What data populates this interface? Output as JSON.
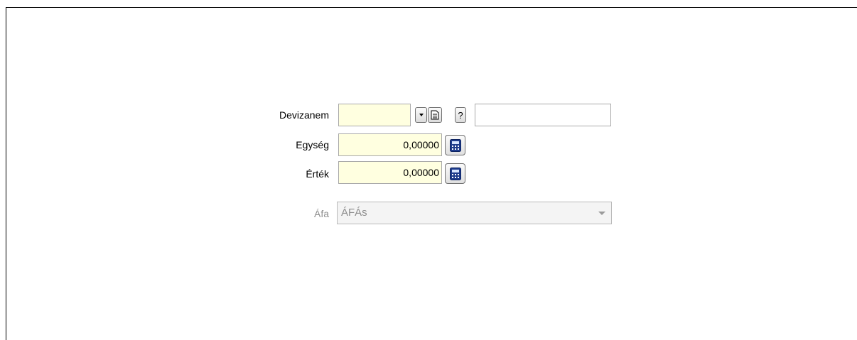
{
  "form": {
    "devizanem": {
      "label": "Devizanem",
      "value": "",
      "dropdown_icon": "dropdown-arrow-icon",
      "document_icon": "document-icon",
      "help_label": "?",
      "name_value": ""
    },
    "egyseg": {
      "label": "Egység",
      "value": "0,00000",
      "calc_icon": "calculator-icon"
    },
    "ertek": {
      "label": "Érték",
      "value": "0,00000",
      "calc_icon": "calculator-icon"
    },
    "afa": {
      "label": "Áfa",
      "value": "ÁFÁs"
    }
  },
  "colors": {
    "input_bg": "#ffffe0",
    "disabled_text": "#8d8d8d",
    "border": "#a9a9a9"
  }
}
